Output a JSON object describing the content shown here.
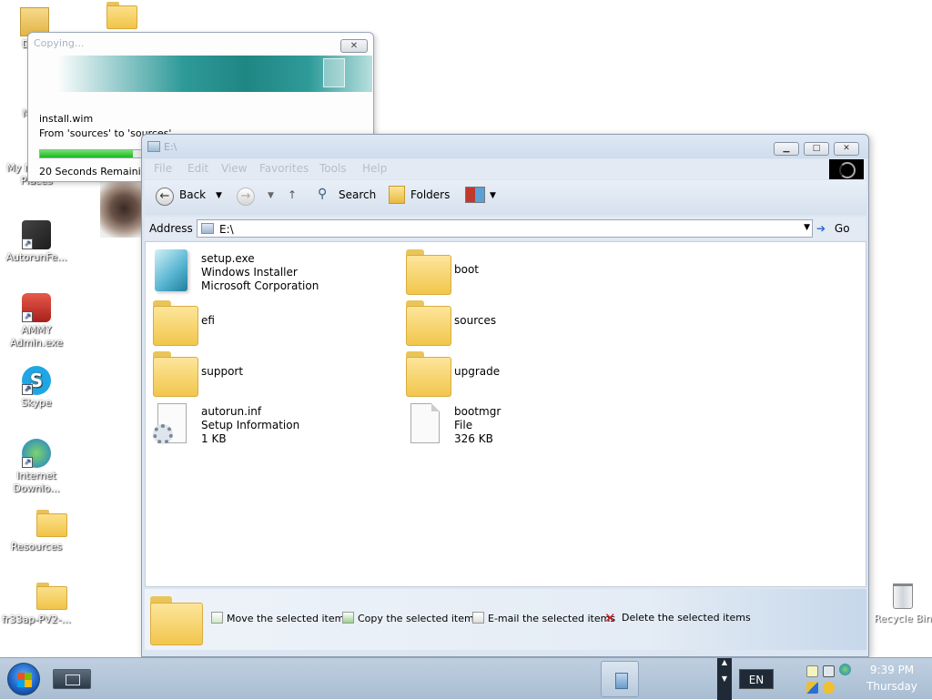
{
  "desktop": {
    "icons": [
      {
        "label": "Docu"
      },
      {
        "label": "My C"
      },
      {
        "label": "My Network Places"
      },
      {
        "label": "AutorunFe..."
      },
      {
        "label": "AMMY Admin.exe"
      },
      {
        "label": "Skype"
      },
      {
        "label": "Internet Downlo..."
      },
      {
        "label": "Resources"
      },
      {
        "label": "fr33ap-PV2-..."
      },
      {
        "label": "Recycle Bin"
      }
    ]
  },
  "copy_dialog": {
    "title": "Copying...",
    "close_glyph": "✕",
    "file_name": "install.wim",
    "from_to": "From 'sources' to 'sources'",
    "remaining": "20 Seconds Remaining",
    "progress_fraction": 0.9
  },
  "explorer": {
    "title": "E:\\",
    "menu": [
      "File",
      "Edit",
      "View",
      "Favorites",
      "Tools",
      "Help"
    ],
    "toolbar": {
      "back": "Back",
      "search": "Search",
      "folders": "Folders"
    },
    "address": {
      "label": "Address",
      "value": "E:\\",
      "go": "Go"
    },
    "items": [
      {
        "name": "setup.exe",
        "line2": "Windows Installer",
        "line3": "Microsoft Corporation",
        "icon": "setup-exe-icon"
      },
      {
        "name": "boot",
        "icon": "folder-icon"
      },
      {
        "name": "efi",
        "icon": "folder-icon"
      },
      {
        "name": "sources",
        "icon": "folder-icon"
      },
      {
        "name": "support",
        "icon": "folder-icon"
      },
      {
        "name": "upgrade",
        "icon": "folder-icon"
      },
      {
        "name": "autorun.inf",
        "line2": "Setup Information",
        "line3": "1 KB",
        "icon": "inf-file-icon"
      },
      {
        "name": "bootmgr",
        "line2": "File",
        "line3": "326 KB",
        "icon": "generic-file-icon"
      }
    ],
    "tasks": [
      "Move the selected items",
      "Copy the selected items",
      "E-mail the selected items",
      "Delete the selected items"
    ]
  },
  "taskbar": {
    "language": "EN",
    "time": "9:39 PM",
    "day": "Thursday"
  }
}
